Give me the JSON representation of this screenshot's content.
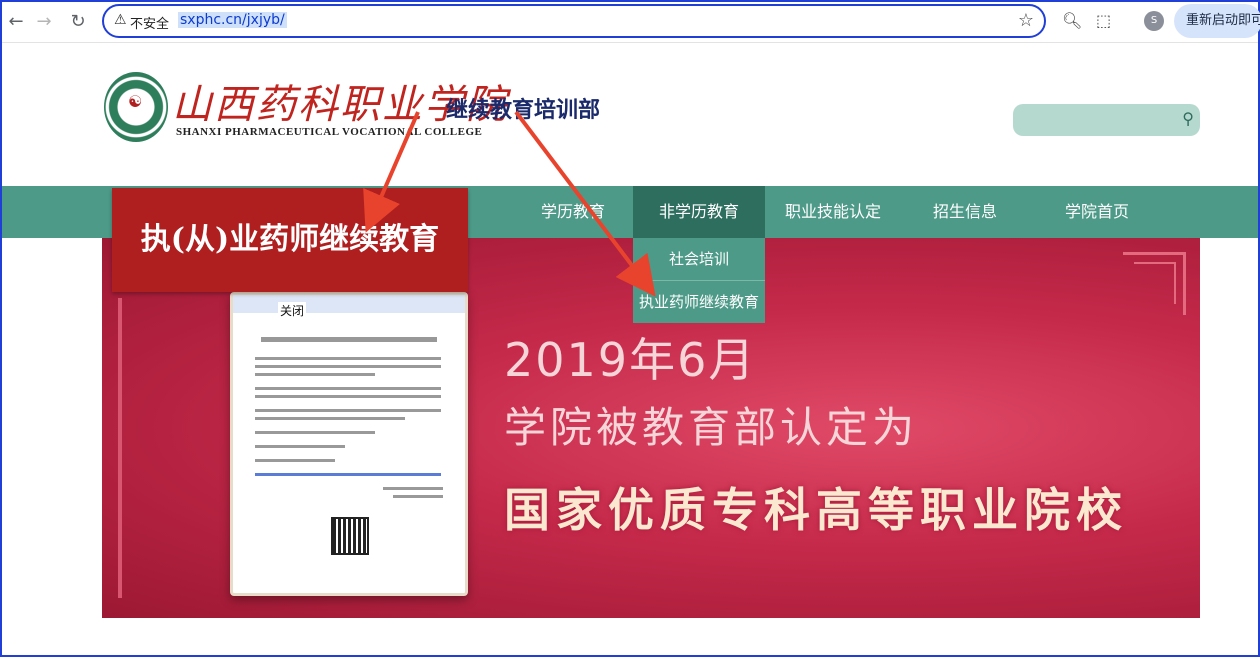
{
  "browser": {
    "security_label": "不安全",
    "url": "sxphc.cn/jxjyb/",
    "profile_initial": "S",
    "restart_label": "重新启动即可"
  },
  "header": {
    "school_name_cn": "山西药科职业学院",
    "school_name_en": "SHANXI PHARMACEUTICAL VOCATIONAL COLLEGE",
    "department": "继续教育培训部"
  },
  "nav": {
    "items": [
      "学历教育",
      "非学历教育",
      "职业技能认定",
      "招生信息",
      "学院首页"
    ],
    "active_index": 1,
    "dropdown": [
      "社会培训",
      "执业药师继续教育"
    ]
  },
  "banner": {
    "line1": "2019年6月",
    "line2": "学院被教育部认定为",
    "line3": "国家优质专科高等职业院校"
  },
  "popup": {
    "close_label": "关闭"
  },
  "annotation": {
    "callout": "执(从)业药师继续教育",
    "color": "#b01f1f",
    "arrow_color": "#e8442d"
  }
}
